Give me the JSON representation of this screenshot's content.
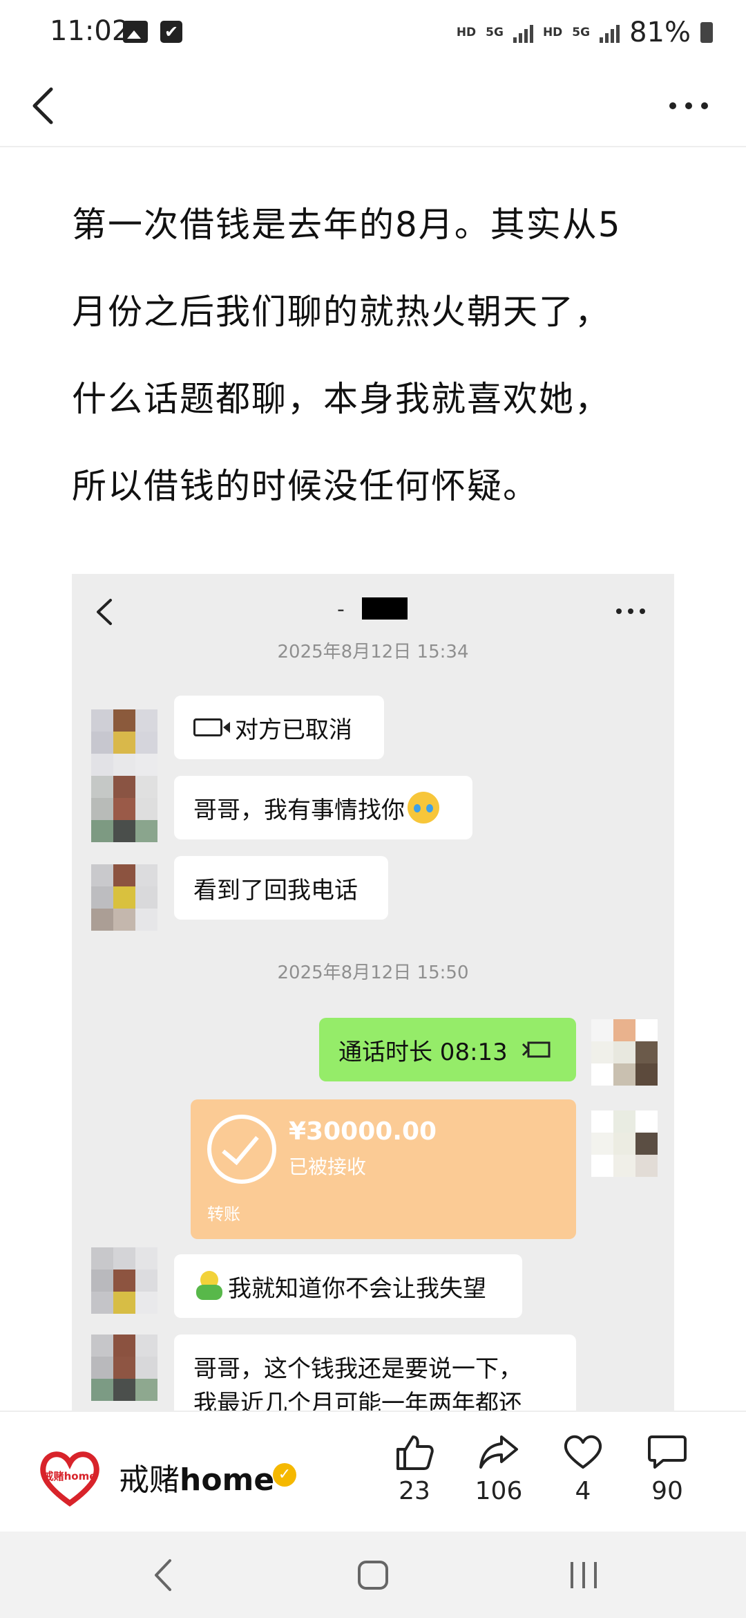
{
  "status_bar": {
    "time": "11:02",
    "network_1": "HD",
    "network_2": "5G",
    "network_3": "HD",
    "network_4": "5G",
    "battery": "81%"
  },
  "nav": {
    "back_icon": "chevron-left-icon",
    "more_icon": "more-horizontal-icon"
  },
  "article": {
    "lines": [
      "第一次借钱是去年的8月。其实从5",
      "月份之后我们聊的就热火朝天了，",
      "什么话题都聊，本身我就喜欢她，",
      "所以借钱的时候没任何怀疑。"
    ]
  },
  "chat": {
    "title_dash": "-",
    "time_1": "2025年8月12日 15:34",
    "time_2": "2025年8月12日 15:50",
    "msg_video_cancel": "对方已取消",
    "msg_1": "哥哥，我有事情找你",
    "msg_2": "看到了回我电话",
    "msg_call_duration": "通话时长 08:13",
    "transfer": {
      "amount": "¥30000.00",
      "status": "已被接收",
      "label": "转账"
    },
    "msg_3": "我就知道你不会让我失望",
    "msg_4_line1": "哥哥，这个钱我还是要说一下，",
    "msg_4_line2": "我最近几个月可能一年两年都还"
  },
  "author": {
    "logo_text": "戒赌home",
    "name_cn": "戒赌",
    "name_en": "home",
    "verified": "✓"
  },
  "actions": {
    "likes": "23",
    "shares": "106",
    "favorites": "4",
    "comments": "90"
  },
  "colors": {
    "chat_bg": "#ededed",
    "green_bubble": "#95ec69",
    "transfer_bg": "#fbcb95",
    "verified": "#f5b800",
    "logo_red": "#d8232a"
  }
}
